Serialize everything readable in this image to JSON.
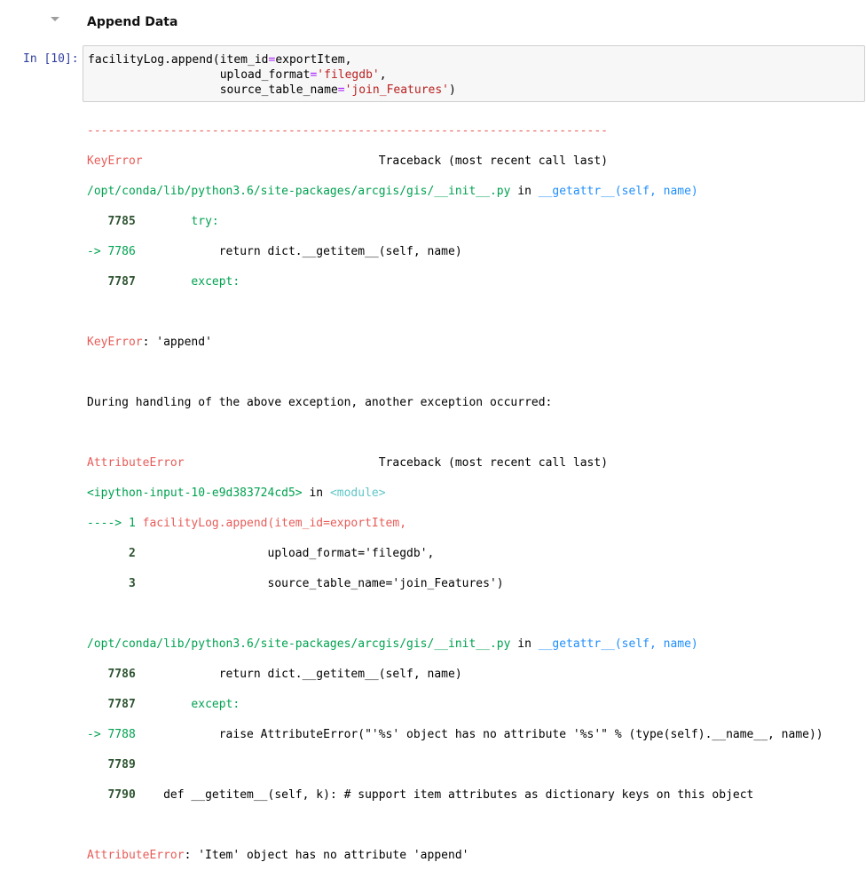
{
  "section": {
    "heading": "Append Data"
  },
  "cell": {
    "prompt": "In [10]:",
    "code": {
      "line1_obj": "facilityLog",
      "line1_call": ".append(item_id",
      "line1_eq": "=",
      "line1_arg": "exportItem,",
      "line2_indent": "                   ",
      "line2_kw": "upload_format",
      "line2_eq": "=",
      "line2_str": "'filegdb'",
      "line2_end": ",",
      "line3_indent": "                   ",
      "line3_kw": "source_table_name",
      "line3_eq": "=",
      "line3_str": "'join_Features'",
      "line3_end": ")"
    }
  },
  "traceback": {
    "dashes": "---------------------------------------------------------------------------",
    "block1": {
      "error_name": "KeyError",
      "gap": "                                  ",
      "traceback_label": "Traceback (most recent call last)",
      "path": "/opt/conda/lib/python3.6/site-packages/arcgis/gis/__init__.py",
      "in_word": " in ",
      "func": "__getattr__",
      "func_args": "(self, name)",
      "l1_num": "   7785",
      "l1_code": "        try:",
      "l2_arrow": "-> 7786",
      "l2_code": "            return dict.__getitem__(self, name)",
      "l3_num": "   7787",
      "l3_code": "        except:",
      "err_name": "KeyError",
      "err_msg": ": 'append'"
    },
    "during": "During handling of the above exception, another exception occurred:",
    "block2": {
      "error_name": "AttributeError",
      "gap": "                            ",
      "traceback_label": "Traceback (most recent call last)",
      "input_ref": "<ipython-input-10-e9d383724cd5>",
      "in_word": " in ",
      "module": "<module>",
      "l1_arrow": "----> 1 ",
      "l1_code": "facilityLog.append(item_id=exportItem,",
      "l2_num": "      2",
      "l2_code": "                   upload_format='filegdb',",
      "l3_num": "      3",
      "l3_code": "                   source_table_name='join_Features')"
    },
    "block3": {
      "path": "/opt/conda/lib/python3.6/site-packages/arcgis/gis/__init__.py",
      "in_word": " in ",
      "func": "__getattr__",
      "func_args": "(self, name)",
      "l1_num": "   7786",
      "l1_code": "            return dict.__getitem__(self, name)",
      "l2_num": "   7787",
      "l2_code": "        except:",
      "l3_arrow": "-> 7788",
      "l3_code_pre": "            raise AttributeError(\"'%s' object has no attribute '%s'\" % (type(self).__name__, name))",
      "l4_num": "   7789",
      "l5_num": "   7790",
      "l5_code": "    def __getitem__(self, k): # support item attributes as dictionary keys on this object",
      "err_name": "AttributeError",
      "err_msg": ": 'Item' object has no attribute 'append'"
    }
  },
  "colors": {
    "prompt": "#303f9f",
    "error_red": "#e75c58",
    "path_green": "#00a250",
    "func_blue": "#208ffb",
    "input_bg": "#f7f7f7"
  },
  "icons": {
    "collapse": "chevron-down-icon"
  }
}
